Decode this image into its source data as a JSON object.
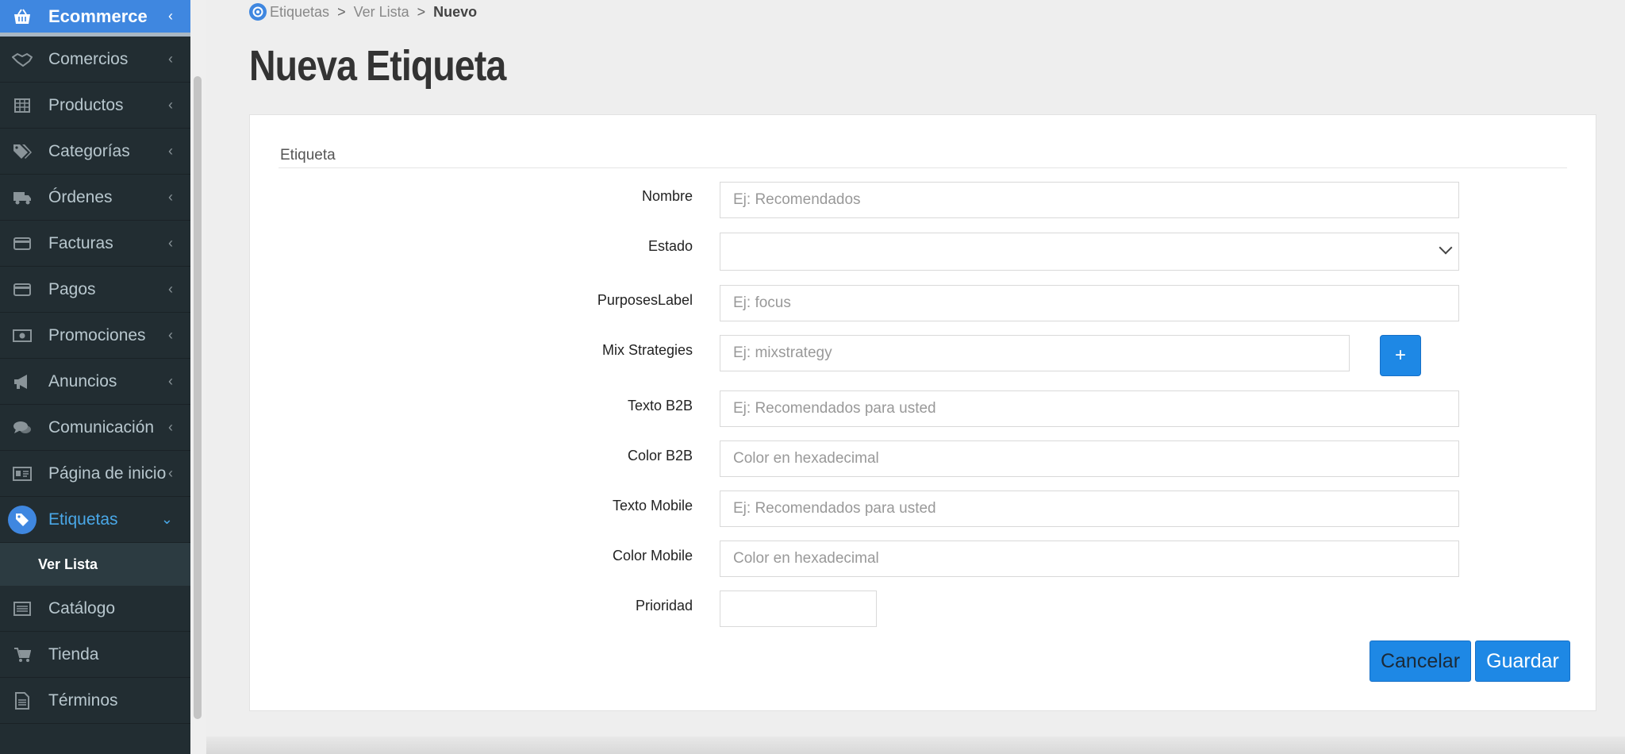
{
  "sidebar": {
    "top": {
      "label": "Ecommerce",
      "icon": "basket-icon"
    },
    "items": [
      {
        "label": "Comercios",
        "icon": "handshake-icon"
      },
      {
        "label": "Productos",
        "icon": "table-icon"
      },
      {
        "label": "Categorías",
        "icon": "tags-icon"
      },
      {
        "label": "Órdenes",
        "icon": "truck-icon"
      },
      {
        "label": "Facturas",
        "icon": "credit-card-icon"
      },
      {
        "label": "Pagos",
        "icon": "credit-card-icon"
      },
      {
        "label": "Promociones",
        "icon": "money-icon"
      },
      {
        "label": "Anuncios",
        "icon": "megaphone-icon"
      },
      {
        "label": "Comunicación",
        "icon": "comments-icon"
      },
      {
        "label": "Página de inicio",
        "icon": "id-card-icon"
      },
      {
        "label": "Etiquetas",
        "icon": "tag-icon"
      },
      {
        "label": "Catálogo",
        "icon": "list-icon"
      },
      {
        "label": "Tienda",
        "icon": "cart-icon"
      },
      {
        "label": "Términos",
        "icon": "file-icon"
      }
    ],
    "sub_item": "Ver Lista",
    "active_color": "#3f87e0"
  },
  "breadcrumb": {
    "items": [
      "Etiquetas",
      "Ver Lista",
      "Nuevo"
    ],
    "separator": ">"
  },
  "page_title": "Nueva Etiqueta",
  "form": {
    "section": "Etiqueta",
    "fields": [
      {
        "label": "Nombre",
        "placeholder": "Ej: Recomendados"
      },
      {
        "label": "Estado",
        "placeholder": ""
      },
      {
        "label": "PurposesLabel",
        "placeholder": "Ej: focus"
      },
      {
        "label": "Mix Strategies",
        "placeholder": "Ej: mixstrategy"
      },
      {
        "label": "Texto B2B",
        "placeholder": "Ej: Recomendados para usted"
      },
      {
        "label": "Color B2B",
        "placeholder": "Color en hexadecimal"
      },
      {
        "label": "Texto Mobile",
        "placeholder": "Ej: Recomendados para usted"
      },
      {
        "label": "Color Mobile",
        "placeholder": "Color en hexadecimal"
      },
      {
        "label": "Prioridad",
        "placeholder": ""
      }
    ],
    "plus_label": "+",
    "cancel_label": "Cancelar",
    "save_label": "Guardar",
    "button_color": "#1e88e5"
  }
}
